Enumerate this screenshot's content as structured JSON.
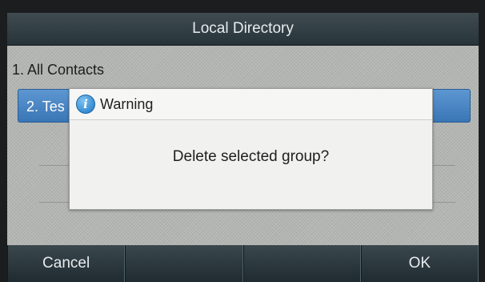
{
  "title": "Local Directory",
  "list": {
    "items": [
      {
        "label": "1. All Contacts"
      },
      {
        "label": "2. Tes"
      }
    ]
  },
  "dialog": {
    "title": "Warning",
    "icon": "info-icon",
    "message": "Delete selected group?"
  },
  "softkeys": [
    {
      "label": "Cancel"
    },
    {
      "label": ""
    },
    {
      "label": ""
    },
    {
      "label": "OK"
    }
  ],
  "colors": {
    "title_bar": "#2f3b41",
    "selected_row": "#4a86c5",
    "dialog_bg": "#f1f1f0"
  }
}
